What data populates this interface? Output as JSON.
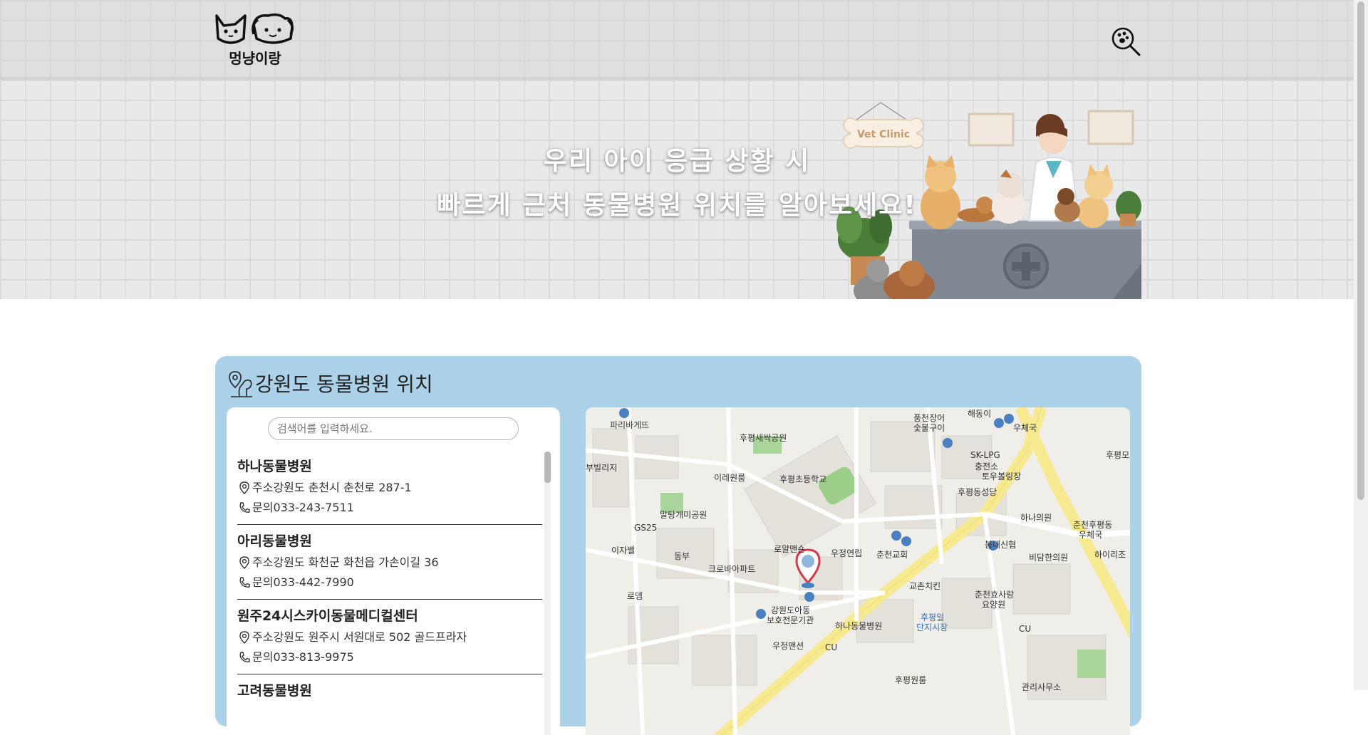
{
  "header": {
    "logo_text": "멍냥이랑",
    "search_icon": "magnifier-paw-icon"
  },
  "hero": {
    "line1": "우리 아이 응급 상황 시",
    "line2": "빠르게 근처 동물병원 위치를 알아보세요!",
    "sign_text": "Vet Clinic"
  },
  "section": {
    "title": "강원도 동물병원 위치",
    "title_icon": "map-pin-pet-icon",
    "search": {
      "placeholder": "검색어를 입력하세요.",
      "value": ""
    },
    "address_prefix": "주소",
    "phone_prefix": "문의",
    "hospitals": [
      {
        "name": "하나동물병원",
        "address": "강원도 춘천시 춘천로 287-1",
        "phone": "033-243-7511"
      },
      {
        "name": "아리동물병원",
        "address": "강원도 화천군 화천읍 가손이길 36",
        "phone": "033-442-7990"
      },
      {
        "name": "원주24시스카이동물메디컬센터",
        "address": "강원도 원주시 서원대로 502 골드프라자",
        "phone": "033-813-9975"
      },
      {
        "name": "고려동물병원",
        "address": "",
        "phone": ""
      }
    ]
  },
  "map": {
    "labels": [
      "파리바게뜨",
      "후평새싹공원",
      "풍천장어",
      "숯불구이",
      "해동이",
      "우체국",
      "후평초등학교",
      "이레원룸",
      "SK-LPG",
      "충전소",
      "후평동성당",
      "토우볼링장",
      "부빌리지",
      "말탕개미공원",
      "GS25",
      "하나의원",
      "후평모",
      "춘천후평동",
      "우체국",
      "봄내신협",
      "로얄맨숀",
      "우정연립",
      "춘천교회",
      "비담한의원",
      "하이리조",
      "이자벨",
      "동부",
      "크로바아파트",
      "교촌치킨",
      "춘천효사랑",
      "요양원",
      "로뎀",
      "강원도아동",
      "보호전문기관",
      "하나동물병원",
      "후평일",
      "단지시장",
      "우정맨션",
      "CU",
      "CU",
      "후평원룸",
      "관리사무소"
    ]
  }
}
